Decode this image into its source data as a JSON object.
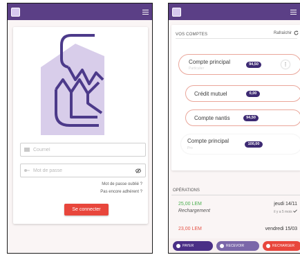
{
  "login": {
    "username_placeholder": "Courriel",
    "password_placeholder": "Mot de passe",
    "forgot_link": "Mot de passe oublié ?",
    "join_link": "Pas encore adhérent ?",
    "connect_button": "Se connecter"
  },
  "accounts": {
    "section_title": "VOS COMPTES",
    "refresh_label": "Rafraîchir",
    "items": [
      {
        "name": "Compte principal",
        "subtitle": "Particulier",
        "balance": "94,50"
      },
      {
        "name": "Crédit mutuel",
        "balance": "0,00"
      },
      {
        "name": "Compte nantis",
        "balance": "94,50"
      },
      {
        "name": "Compte principal",
        "subtitle": "Pro",
        "balance": "100,00"
      }
    ]
  },
  "operations": {
    "section_title": "OPÉRATIONS",
    "items": [
      {
        "amount": "25,00 LEM",
        "label": "Rechargement",
        "date": "jeudi 14/11",
        "ago": "il y a 5 mois"
      },
      {
        "amount": "23,00 LEM",
        "date": "vendredi 15/03"
      }
    ]
  },
  "bottom": {
    "pay": "PAYER",
    "receive": "RECEVOIR",
    "recharge": "RECHARGER"
  },
  "colors": {
    "appbar": "#5b3f86",
    "accent_red": "#e8463c",
    "pill": "#3d2a73",
    "positive": "#4caf50",
    "negative": "#e55347"
  }
}
